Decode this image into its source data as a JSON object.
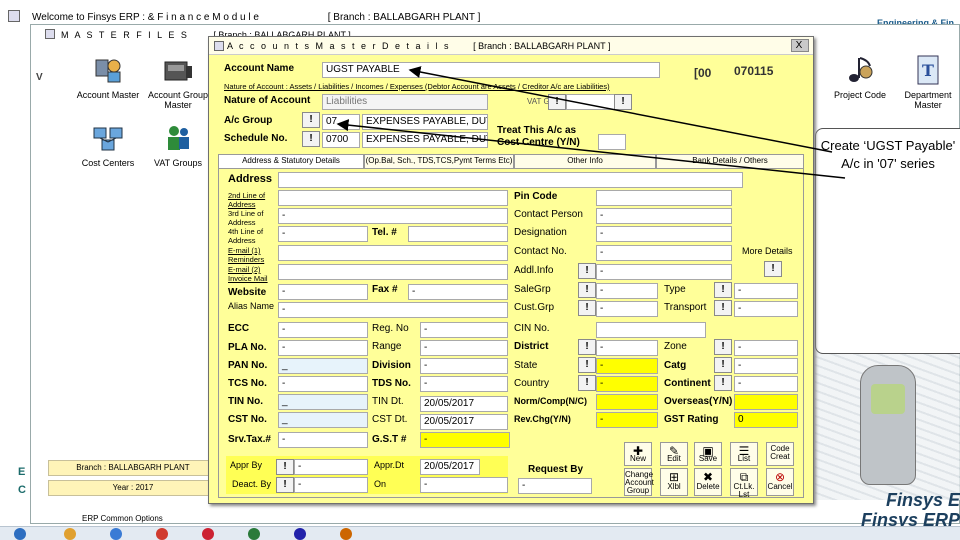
{
  "window": {
    "title": "Welcome to Finsys ERP  :  & F i n a n c e   M o d u l e",
    "branch": "[ Branch : BALLABGARH PLANT ]",
    "brand_right": "Engineering & Fin"
  },
  "master_files": {
    "title": "M A S T E R   F I L E S",
    "branch": "[ Branch : BALLABGARH PLANT ]",
    "tiles": [
      {
        "label": "Account Master",
        "icon": "account-master-icon"
      },
      {
        "label": "Account Group Master",
        "icon": "account-group-icon"
      },
      {
        "label": "Cost Centers",
        "icon": "cost-centers-icon"
      },
      {
        "label": "VAT Groups",
        "icon": "vat-groups-icon"
      }
    ],
    "right_tiles": [
      {
        "label": "Project Code",
        "icon": "music-notes-icon"
      },
      {
        "label": "Department Master",
        "icon": "department-icon"
      }
    ],
    "branch_strip": "Branch : BALLABGARH PLANT",
    "year_strip": "Year : 2017",
    "common_options": "ERP Common Options",
    "side_letters": [
      "V",
      "E",
      "C"
    ]
  },
  "dialog": {
    "title": "A c c o u n t s   M a s t e r   D e t a i l s",
    "branch": "[ Branch : BALLABGARH PLANT ]",
    "close_label": "X",
    "account_name_label": "Account Name",
    "account_name_value": "UGST PAYABLE",
    "code_prefix": "[00",
    "code_value": "070115",
    "nature_hint": "Nature of Account : Assets / Liabilities / Incomes / Expenses (Debtor Account are Assets / Creditor A/c are Liabilities)",
    "nature_label": "Nature of Account",
    "nature_value": "Liabilities",
    "vat_grp_label": "VAT GRP",
    "ac_group_label": "A/c Group",
    "ac_group_code": "07",
    "ac_group_name": "EXPENSES PAYABLE, DUTIES",
    "schedule_label": "Schedule No.",
    "schedule_code": "0700",
    "schedule_name": "EXPENSES PAYABLE, DUTIES",
    "treat_label": "Treat This A/c as Cost Centre (Y/N)",
    "bang": "!",
    "tabs": [
      "Address & Statutory Details",
      "(Op.Bal, Sch., TDS,TCS,Pymt Terms Etc)",
      "Other Info",
      "Bank Details / Others"
    ],
    "fields": {
      "address": "Address",
      "address2": "2nd Line of Address",
      "address3": "3rd Line of Address",
      "address4": "4th Line of Address",
      "email1": "E-mail (1) Reminders",
      "email2": "E-mail (2) Invoice Mail",
      "website": "Website",
      "alias": "Alias Name",
      "ecc": "ECC",
      "pla": "PLA No.",
      "pan": "PAN No.",
      "tcs": "TCS No.",
      "tin": "TIN No.",
      "cst": "CST No.",
      "srv": "Srv.Tax.#",
      "appr_by": "Appr By",
      "deact_by": "Deact. By",
      "tel": "Tel. #",
      "fax": "Fax #",
      "reg": "Reg. No",
      "range": "Range",
      "division": "Division",
      "tds": "TDS No.",
      "tin_dt": "TIN Dt.",
      "cst_dt": "CST Dt.",
      "gst": "G.S.T #",
      "appr_dt": "Appr.Dt",
      "on": "On",
      "pin": "Pin Code",
      "contact_person": "Contact Person",
      "designation": "Designation",
      "contact_no": "Contact No.",
      "addl_info": "Addl.Info",
      "sale_grp": "SaleGrp",
      "cust_grp": "Cust.Grp",
      "cin": "CIN No.",
      "district": "District",
      "state": "State",
      "country": "Country",
      "norm_comp": "Norm/Comp(N/C)",
      "rev_chg": "Rev.Chg(Y/N)",
      "request_by": "Request By",
      "more_details": "More Details",
      "type": "Type",
      "transport": "Transport",
      "zone": "Zone",
      "catg": "Catg",
      "continent": "Continent",
      "overseas": "Overseas(Y/N)",
      "gst_rating": "GST Rating"
    },
    "values": {
      "tin_dt": "20/05/2017",
      "cst_dt": "20/05/2017",
      "appr_dt": "20/05/2017",
      "gst_rating": "0",
      "dash": "-",
      "underscore": "_"
    },
    "toolbar": [
      {
        "label": "New",
        "icon": "new-icon"
      },
      {
        "label": "Edit",
        "icon": "edit-icon"
      },
      {
        "label": "Save",
        "icon": "save-icon"
      },
      {
        "label": "List",
        "icon": "list-icon"
      },
      {
        "label": "Code Creat",
        "icon": "code-create-icon"
      },
      {
        "label": "Change Account Group",
        "icon": "change-group-icon"
      },
      {
        "label": "Xlbl",
        "icon": "excel-icon"
      },
      {
        "label": "Delete",
        "icon": "delete-icon"
      },
      {
        "label": "Ct.Lk. Lst",
        "icon": "link-list-icon"
      },
      {
        "label": "Cancel",
        "icon": "cancel-icon"
      }
    ]
  },
  "annotation": "Create ‘UGST Payable' A/c in '07' series",
  "finsys_logo": [
    "Finsys E",
    "Finsys ERP"
  ]
}
